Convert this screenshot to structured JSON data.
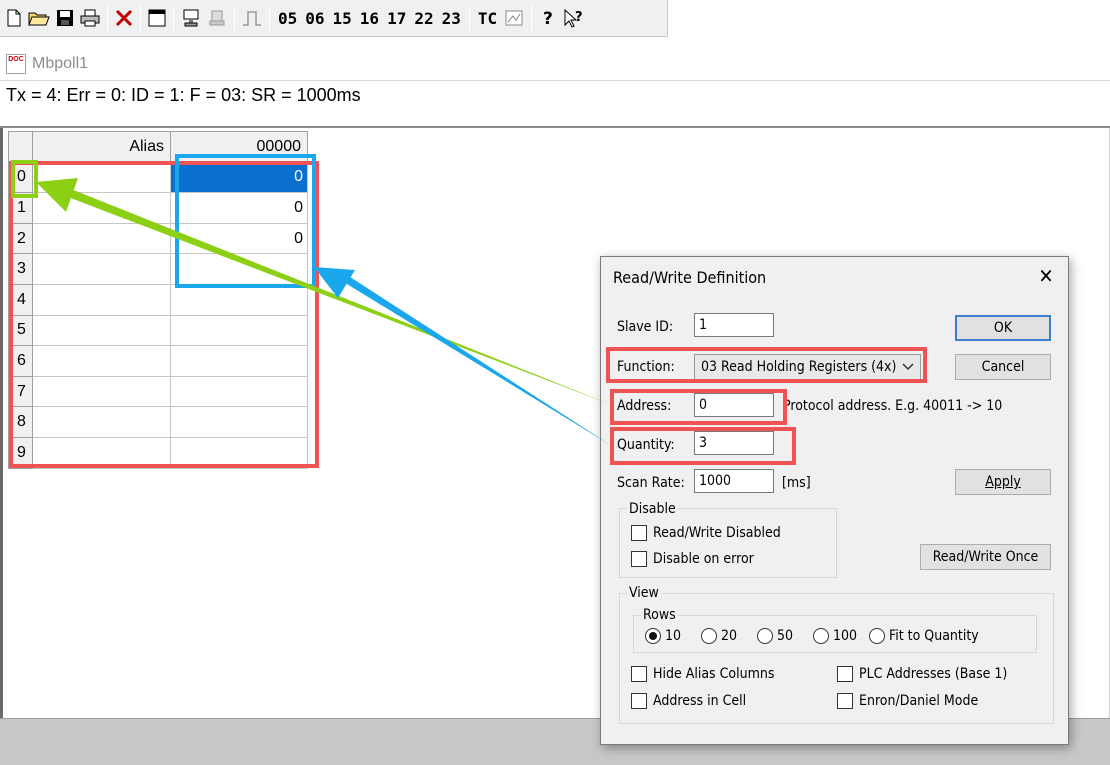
{
  "toolbar": {
    "icons": [
      "new-file-icon",
      "open-folder-icon",
      "save-icon",
      "print-icon",
      "delete-icon",
      "window-icon",
      "connect-icon",
      "disconnect-icon",
      "pulse-icon",
      "tc-icon",
      "monitor-icon",
      "help-icon",
      "context-help-icon"
    ],
    "function_codes": [
      "05",
      "06",
      "15",
      "16",
      "17",
      "22",
      "23"
    ],
    "tc_label": "TC"
  },
  "window": {
    "title": "Mbpoll1",
    "doc_icon_text": "DOC",
    "status": "Tx = 4: Err = 0: ID = 1: F = 03: SR = 1000ms"
  },
  "grid": {
    "headers": {
      "alias": "Alias",
      "value": "00000"
    },
    "rows": [
      {
        "index": "0",
        "alias": "",
        "value": "0"
      },
      {
        "index": "1",
        "alias": "",
        "value": "0"
      },
      {
        "index": "2",
        "alias": "",
        "value": "0"
      },
      {
        "index": "3",
        "alias": "",
        "value": ""
      },
      {
        "index": "4",
        "alias": "",
        "value": ""
      },
      {
        "index": "5",
        "alias": "",
        "value": ""
      },
      {
        "index": "6",
        "alias": "",
        "value": ""
      },
      {
        "index": "7",
        "alias": "",
        "value": ""
      },
      {
        "index": "8",
        "alias": "",
        "value": ""
      },
      {
        "index": "9",
        "alias": "",
        "value": ""
      }
    ]
  },
  "dialog": {
    "title": "Read/Write Definition",
    "close": "✕",
    "slave_id": {
      "label": "Slave ID:",
      "value": "1"
    },
    "function": {
      "label": "Function:",
      "value": "03 Read Holding Registers (4x)"
    },
    "address": {
      "label": "Address:",
      "value": "0",
      "hint": "Protocol address. E.g. 40011 -> 10"
    },
    "quantity": {
      "label": "Quantity:",
      "value": "3"
    },
    "scan_rate": {
      "label": "Scan Rate:",
      "value": "1000",
      "unit": "[ms]"
    },
    "buttons": {
      "ok": "OK",
      "cancel": "Cancel",
      "apply": "Apply",
      "rw_once": "Read/Write Once"
    },
    "disable": {
      "caption": "Disable",
      "rw_disabled": "Read/Write Disabled",
      "on_error": "Disable on error"
    },
    "view": {
      "caption": "View",
      "rows_caption": "Rows",
      "rows_options": [
        "10",
        "20",
        "50",
        "100",
        "Fit to Quantity"
      ],
      "rows_selected": "10",
      "hide_alias": "Hide Alias Columns",
      "plc_addresses": "PLC Addresses (Base 1)",
      "address_in_cell": "Address in Cell",
      "enron": "Enron/Daniel Mode"
    }
  },
  "colors": {
    "red_box": "#ef5353",
    "blue_box": "#1ba7ec",
    "green_box": "#8ccf14",
    "selection": "#0a70d0"
  }
}
